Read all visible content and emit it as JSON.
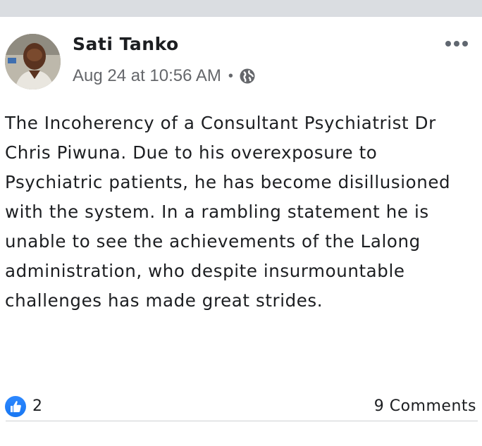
{
  "post": {
    "author": "Sati Tanko",
    "timestamp": "Aug 24 at 10:56 AM",
    "separator": "•",
    "privacy_icon": "globe-icon",
    "more_icon": "more-options-icon",
    "body": "The Incoherency of a Consultant Psychiatrist Dr Chris Piwuna. Due to his overexposure to Psychiatric patients, he has become disillusioned with the system. In a rambling statement he is unable to see the achievements of the Lalong administration, who despite insurmountable challenges has made great strides.",
    "reactions": {
      "icon": "thumbs-up-icon",
      "count": "2",
      "color": "#1877f2"
    },
    "comments_label": "9 Comments"
  }
}
